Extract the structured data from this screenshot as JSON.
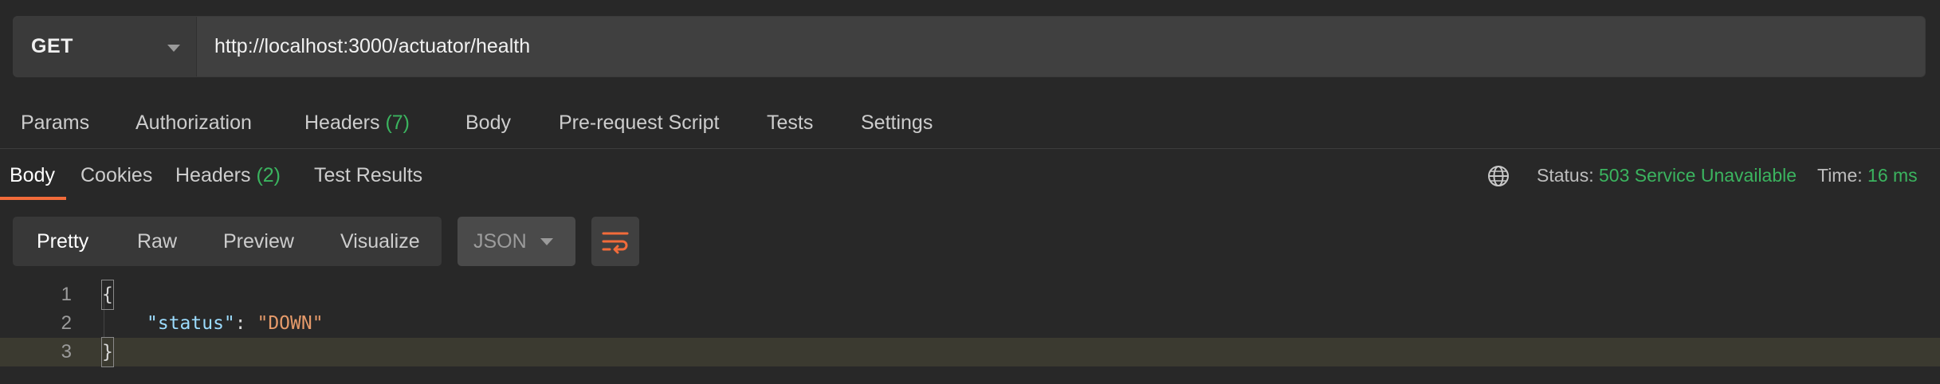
{
  "request": {
    "method": "GET",
    "url": "http://localhost:3000/actuator/health"
  },
  "request_tabs": [
    {
      "label": "Params"
    },
    {
      "label": "Authorization"
    },
    {
      "label": "Headers",
      "count": "(7)"
    },
    {
      "label": "Body"
    },
    {
      "label": "Pre-request Script"
    },
    {
      "label": "Tests"
    },
    {
      "label": "Settings"
    }
  ],
  "response_tabs": [
    {
      "label": "Body",
      "active": true
    },
    {
      "label": "Cookies"
    },
    {
      "label": "Headers",
      "count": "(2)"
    },
    {
      "label": "Test Results"
    }
  ],
  "response_meta": {
    "status_label": "Status:",
    "status_value": "503 Service Unavailable",
    "time_label": "Time:",
    "time_value": "16 ms"
  },
  "view_modes": [
    {
      "label": "Pretty",
      "active": true
    },
    {
      "label": "Raw"
    },
    {
      "label": "Preview"
    },
    {
      "label": "Visualize"
    }
  ],
  "format": {
    "selected": "JSON"
  },
  "code_lines": [
    {
      "number": "1",
      "text": "{"
    },
    {
      "number": "2",
      "key": "\"status\"",
      "colon": ": ",
      "value": "\"DOWN\""
    },
    {
      "number": "3",
      "text": "}"
    }
  ],
  "colors": {
    "accent": "#f26b3a",
    "success": "#3bb45f",
    "background": "#282828"
  },
  "icons": {
    "method_caret": "chevron-down-icon",
    "format_caret": "chevron-down-icon",
    "network": "globe-icon",
    "wrap": "wrap-lines-icon"
  }
}
